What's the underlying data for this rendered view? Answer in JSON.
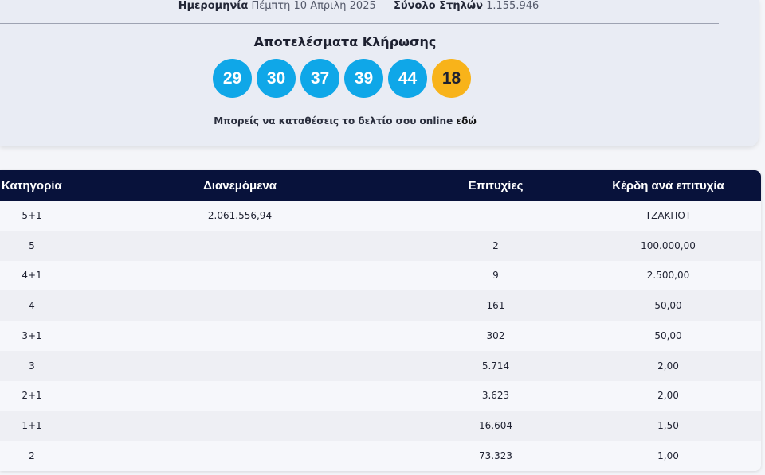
{
  "header": {
    "date_label": "Ημερομηνία",
    "date_value": "Πέμπτη 10 Απριλη 2025",
    "columns_label": "Σύνολο Στηλών",
    "columns_value": "1.155.946"
  },
  "draw": {
    "title": "Αποτελέσματα Κλήρωσης",
    "numbers": [
      "29",
      "30",
      "37",
      "39",
      "44"
    ],
    "joker": "18",
    "colors": {
      "main_ball": "#0fa7e8",
      "joker_ball": "#f8b31a"
    }
  },
  "online_note": {
    "text": "Μπορείς να καταθέσεις το δελτίο σου online",
    "link": "εδώ"
  },
  "table": {
    "headers": [
      "Κατηγορία",
      "Διανεμόμενα",
      "Επιτυχίες",
      "Κέρδη ανά επιτυχία"
    ],
    "header_color": "#08123b",
    "rows": [
      [
        "5+1",
        "2.061.556,94",
        "-",
        "ΤΖΑΚΠΟΤ"
      ],
      [
        "5",
        "",
        "2",
        "100.000,00"
      ],
      [
        "4+1",
        "",
        "9",
        "2.500,00"
      ],
      [
        "4",
        "",
        "161",
        "50,00"
      ],
      [
        "3+1",
        "",
        "302",
        "50,00"
      ],
      [
        "3",
        "",
        "5.714",
        "2,00"
      ],
      [
        "2+1",
        "",
        "3.623",
        "2,00"
      ],
      [
        "1+1",
        "",
        "16.604",
        "1,50"
      ],
      [
        "2",
        "",
        "73.323",
        "1,00"
      ]
    ]
  }
}
